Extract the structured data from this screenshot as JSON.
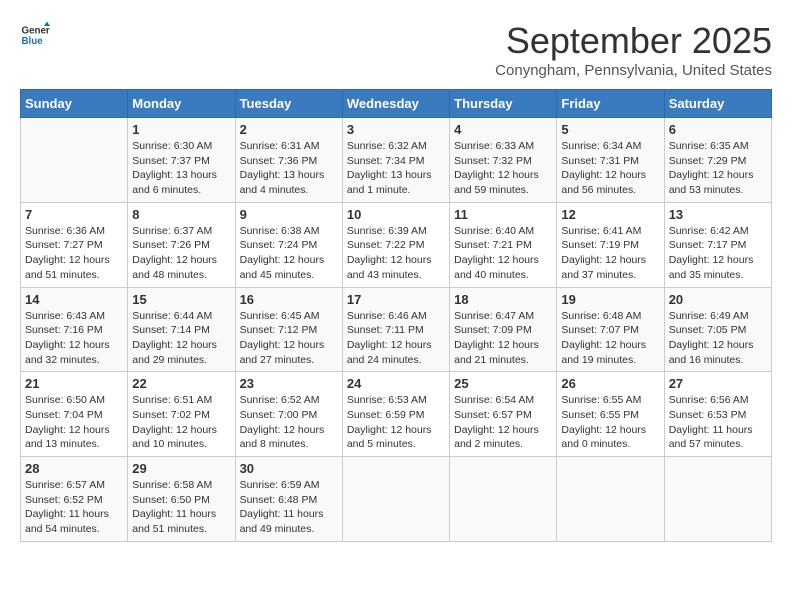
{
  "header": {
    "logo_line1": "General",
    "logo_line2": "Blue",
    "month": "September 2025",
    "location": "Conyngham, Pennsylvania, United States"
  },
  "weekdays": [
    "Sunday",
    "Monday",
    "Tuesday",
    "Wednesday",
    "Thursday",
    "Friday",
    "Saturday"
  ],
  "weeks": [
    [
      {
        "day": "",
        "sunrise": "",
        "sunset": "",
        "daylight": ""
      },
      {
        "day": "1",
        "sunrise": "Sunrise: 6:30 AM",
        "sunset": "Sunset: 7:37 PM",
        "daylight": "Daylight: 13 hours and 6 minutes."
      },
      {
        "day": "2",
        "sunrise": "Sunrise: 6:31 AM",
        "sunset": "Sunset: 7:36 PM",
        "daylight": "Daylight: 13 hours and 4 minutes."
      },
      {
        "day": "3",
        "sunrise": "Sunrise: 6:32 AM",
        "sunset": "Sunset: 7:34 PM",
        "daylight": "Daylight: 13 hours and 1 minute."
      },
      {
        "day": "4",
        "sunrise": "Sunrise: 6:33 AM",
        "sunset": "Sunset: 7:32 PM",
        "daylight": "Daylight: 12 hours and 59 minutes."
      },
      {
        "day": "5",
        "sunrise": "Sunrise: 6:34 AM",
        "sunset": "Sunset: 7:31 PM",
        "daylight": "Daylight: 12 hours and 56 minutes."
      },
      {
        "day": "6",
        "sunrise": "Sunrise: 6:35 AM",
        "sunset": "Sunset: 7:29 PM",
        "daylight": "Daylight: 12 hours and 53 minutes."
      }
    ],
    [
      {
        "day": "7",
        "sunrise": "Sunrise: 6:36 AM",
        "sunset": "Sunset: 7:27 PM",
        "daylight": "Daylight: 12 hours and 51 minutes."
      },
      {
        "day": "8",
        "sunrise": "Sunrise: 6:37 AM",
        "sunset": "Sunset: 7:26 PM",
        "daylight": "Daylight: 12 hours and 48 minutes."
      },
      {
        "day": "9",
        "sunrise": "Sunrise: 6:38 AM",
        "sunset": "Sunset: 7:24 PM",
        "daylight": "Daylight: 12 hours and 45 minutes."
      },
      {
        "day": "10",
        "sunrise": "Sunrise: 6:39 AM",
        "sunset": "Sunset: 7:22 PM",
        "daylight": "Daylight: 12 hours and 43 minutes."
      },
      {
        "day": "11",
        "sunrise": "Sunrise: 6:40 AM",
        "sunset": "Sunset: 7:21 PM",
        "daylight": "Daylight: 12 hours and 40 minutes."
      },
      {
        "day": "12",
        "sunrise": "Sunrise: 6:41 AM",
        "sunset": "Sunset: 7:19 PM",
        "daylight": "Daylight: 12 hours and 37 minutes."
      },
      {
        "day": "13",
        "sunrise": "Sunrise: 6:42 AM",
        "sunset": "Sunset: 7:17 PM",
        "daylight": "Daylight: 12 hours and 35 minutes."
      }
    ],
    [
      {
        "day": "14",
        "sunrise": "Sunrise: 6:43 AM",
        "sunset": "Sunset: 7:16 PM",
        "daylight": "Daylight: 12 hours and 32 minutes."
      },
      {
        "day": "15",
        "sunrise": "Sunrise: 6:44 AM",
        "sunset": "Sunset: 7:14 PM",
        "daylight": "Daylight: 12 hours and 29 minutes."
      },
      {
        "day": "16",
        "sunrise": "Sunrise: 6:45 AM",
        "sunset": "Sunset: 7:12 PM",
        "daylight": "Daylight: 12 hours and 27 minutes."
      },
      {
        "day": "17",
        "sunrise": "Sunrise: 6:46 AM",
        "sunset": "Sunset: 7:11 PM",
        "daylight": "Daylight: 12 hours and 24 minutes."
      },
      {
        "day": "18",
        "sunrise": "Sunrise: 6:47 AM",
        "sunset": "Sunset: 7:09 PM",
        "daylight": "Daylight: 12 hours and 21 minutes."
      },
      {
        "day": "19",
        "sunrise": "Sunrise: 6:48 AM",
        "sunset": "Sunset: 7:07 PM",
        "daylight": "Daylight: 12 hours and 19 minutes."
      },
      {
        "day": "20",
        "sunrise": "Sunrise: 6:49 AM",
        "sunset": "Sunset: 7:05 PM",
        "daylight": "Daylight: 12 hours and 16 minutes."
      }
    ],
    [
      {
        "day": "21",
        "sunrise": "Sunrise: 6:50 AM",
        "sunset": "Sunset: 7:04 PM",
        "daylight": "Daylight: 12 hours and 13 minutes."
      },
      {
        "day": "22",
        "sunrise": "Sunrise: 6:51 AM",
        "sunset": "Sunset: 7:02 PM",
        "daylight": "Daylight: 12 hours and 10 minutes."
      },
      {
        "day": "23",
        "sunrise": "Sunrise: 6:52 AM",
        "sunset": "Sunset: 7:00 PM",
        "daylight": "Daylight: 12 hours and 8 minutes."
      },
      {
        "day": "24",
        "sunrise": "Sunrise: 6:53 AM",
        "sunset": "Sunset: 6:59 PM",
        "daylight": "Daylight: 12 hours and 5 minutes."
      },
      {
        "day": "25",
        "sunrise": "Sunrise: 6:54 AM",
        "sunset": "Sunset: 6:57 PM",
        "daylight": "Daylight: 12 hours and 2 minutes."
      },
      {
        "day": "26",
        "sunrise": "Sunrise: 6:55 AM",
        "sunset": "Sunset: 6:55 PM",
        "daylight": "Daylight: 12 hours and 0 minutes."
      },
      {
        "day": "27",
        "sunrise": "Sunrise: 6:56 AM",
        "sunset": "Sunset: 6:53 PM",
        "daylight": "Daylight: 11 hours and 57 minutes."
      }
    ],
    [
      {
        "day": "28",
        "sunrise": "Sunrise: 6:57 AM",
        "sunset": "Sunset: 6:52 PM",
        "daylight": "Daylight: 11 hours and 54 minutes."
      },
      {
        "day": "29",
        "sunrise": "Sunrise: 6:58 AM",
        "sunset": "Sunset: 6:50 PM",
        "daylight": "Daylight: 11 hours and 51 minutes."
      },
      {
        "day": "30",
        "sunrise": "Sunrise: 6:59 AM",
        "sunset": "Sunset: 6:48 PM",
        "daylight": "Daylight: 11 hours and 49 minutes."
      },
      {
        "day": "",
        "sunrise": "",
        "sunset": "",
        "daylight": ""
      },
      {
        "day": "",
        "sunrise": "",
        "sunset": "",
        "daylight": ""
      },
      {
        "day": "",
        "sunrise": "",
        "sunset": "",
        "daylight": ""
      },
      {
        "day": "",
        "sunrise": "",
        "sunset": "",
        "daylight": ""
      }
    ]
  ]
}
